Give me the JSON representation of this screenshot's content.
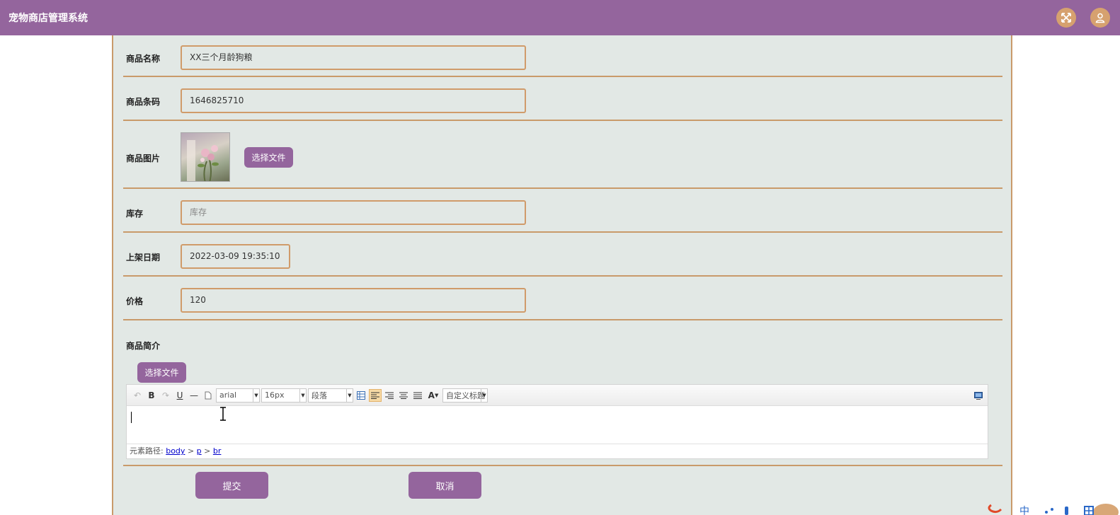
{
  "app": {
    "title": "宠物商店管理系统"
  },
  "header": {
    "icons": [
      "fullscreen-icon",
      "user-icon"
    ]
  },
  "form": {
    "name": {
      "label": "商品名称",
      "value": "XX三个月龄狗粮"
    },
    "barcode": {
      "label": "商品条码",
      "value": "1646825710"
    },
    "image": {
      "label": "商品图片",
      "button": "选择文件"
    },
    "stock": {
      "label": "库存",
      "placeholder": "库存"
    },
    "date": {
      "label": "上架日期",
      "value": "2022-03-09 19:35:10"
    },
    "price": {
      "label": "价格",
      "value": "120"
    },
    "intro": {
      "label": "商品简介",
      "button": "选择文件"
    }
  },
  "editor": {
    "font_family": "arial",
    "font_size": "16px",
    "paragraph": "段落",
    "custom_title": "自定义标题",
    "status_prefix": "元素路径:",
    "path": [
      "body",
      "p",
      "br"
    ],
    "sep": ">"
  },
  "actions": {
    "submit": "提交",
    "cancel": "取消"
  },
  "colors": {
    "header": "#94659d",
    "accent": "#d6a16f",
    "border": "#c99a6a",
    "panel": "#e2e8e5"
  }
}
